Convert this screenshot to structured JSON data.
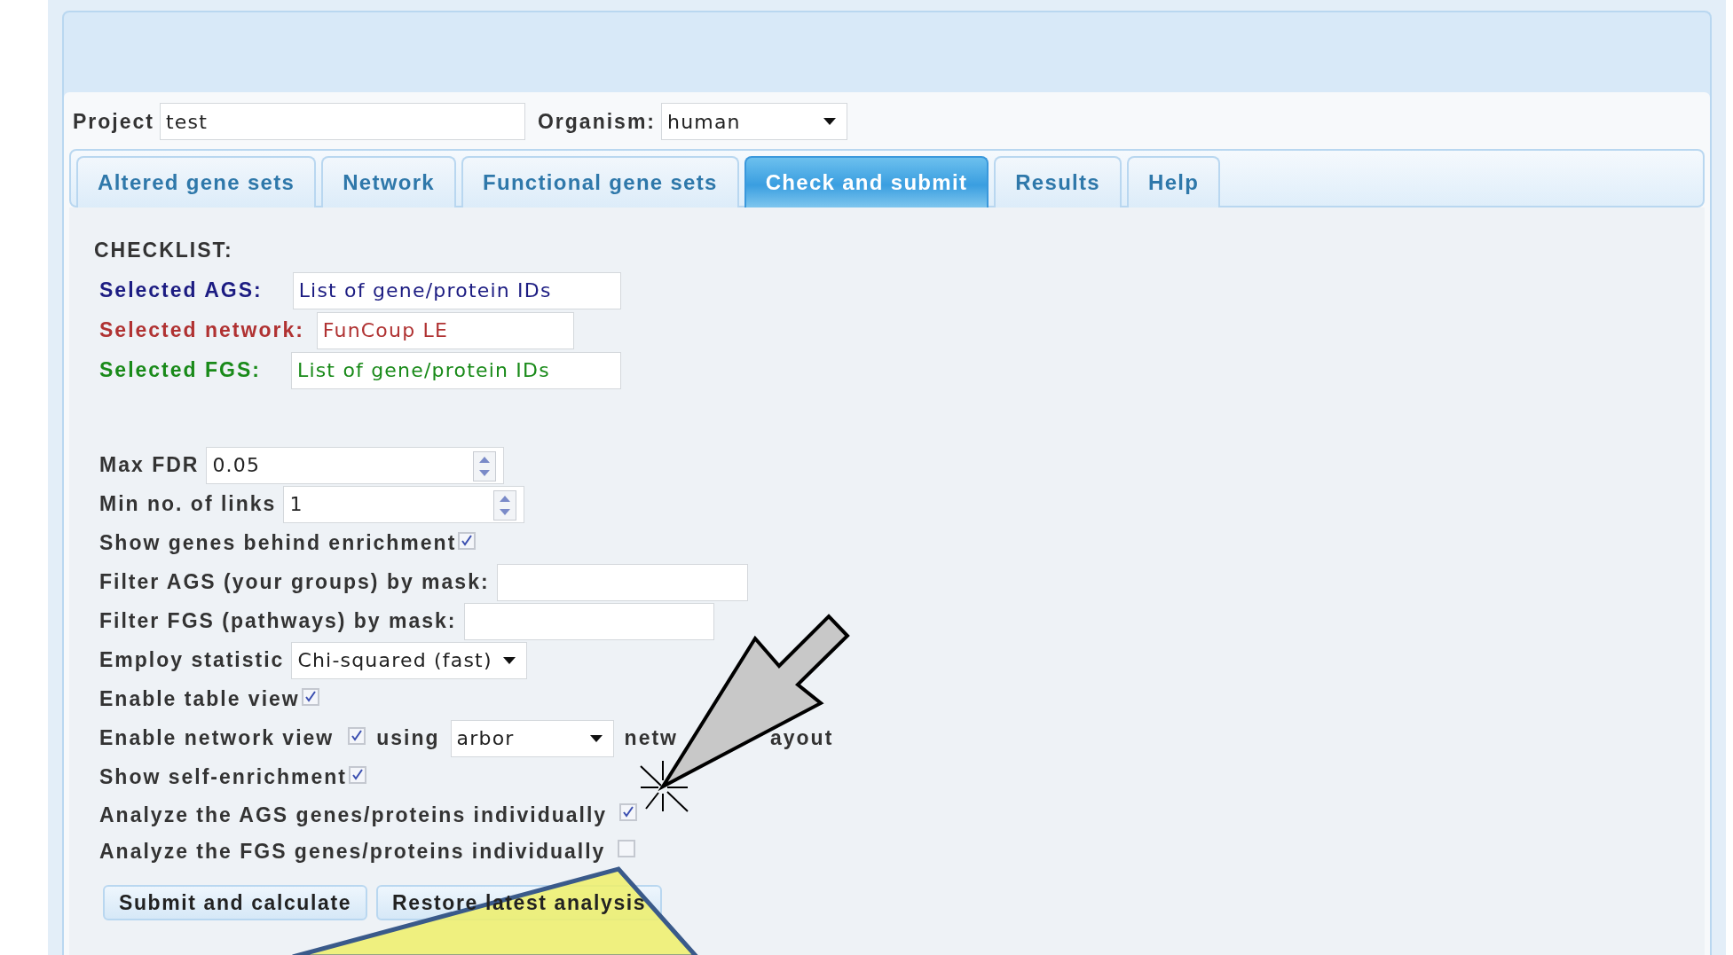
{
  "project": {
    "label": "Project",
    "value": "test"
  },
  "organism": {
    "label": "Organism:",
    "value": "human"
  },
  "tabs": [
    {
      "label": "Altered gene sets",
      "selected": false
    },
    {
      "label": "Network",
      "selected": false
    },
    {
      "label": "Functional gene sets",
      "selected": false
    },
    {
      "label": "Check and submit",
      "selected": true
    },
    {
      "label": "Results",
      "selected": false
    },
    {
      "label": "Help",
      "selected": false
    }
  ],
  "checklist": {
    "title": "CHECKLIST:",
    "items": [
      {
        "label": "Selected AGS:",
        "value": "List of gene/protein IDs",
        "color": "#1c1c82"
      },
      {
        "label": "Selected network:",
        "value": "FunCoup LE",
        "color": "#b03232"
      },
      {
        "label": "Selected FGS:",
        "value": "List of gene/protein IDs",
        "color": "#198a19"
      }
    ]
  },
  "options": [
    {
      "kind": "number",
      "label": "Max FDR",
      "value": "0.05"
    },
    {
      "kind": "number",
      "label": "Min no. of links",
      "value": "1"
    },
    {
      "kind": "checkbox",
      "label": "Show genes behind enrichment",
      "checked": true
    },
    {
      "kind": "text",
      "label": "Filter AGS (your groups) by mask:"
    },
    {
      "kind": "text",
      "label": "Filter FGS (pathways) by mask:"
    },
    {
      "kind": "select",
      "label": "Employ statistic",
      "value": "Chi-squared (fast)"
    },
    {
      "kind": "checkbox",
      "label": "Enable table view",
      "checked": true
    },
    {
      "kind": "network",
      "label": "Enable network view",
      "checked": true,
      "joiner": "using",
      "value": "arbor",
      "after": [
        "netw",
        "ayout"
      ]
    },
    {
      "kind": "checkbox",
      "label": "Show self-enrichment",
      "checked": true
    },
    {
      "kind": "checkbox",
      "label": "Analyze the AGS genes/proteins individually",
      "checked": true
    },
    {
      "kind": "checkbox",
      "label": "Analyze the FGS genes/proteins individually",
      "checked": false
    }
  ],
  "buttons": [
    "Submit and calculate",
    "Restore latest analysis"
  ]
}
